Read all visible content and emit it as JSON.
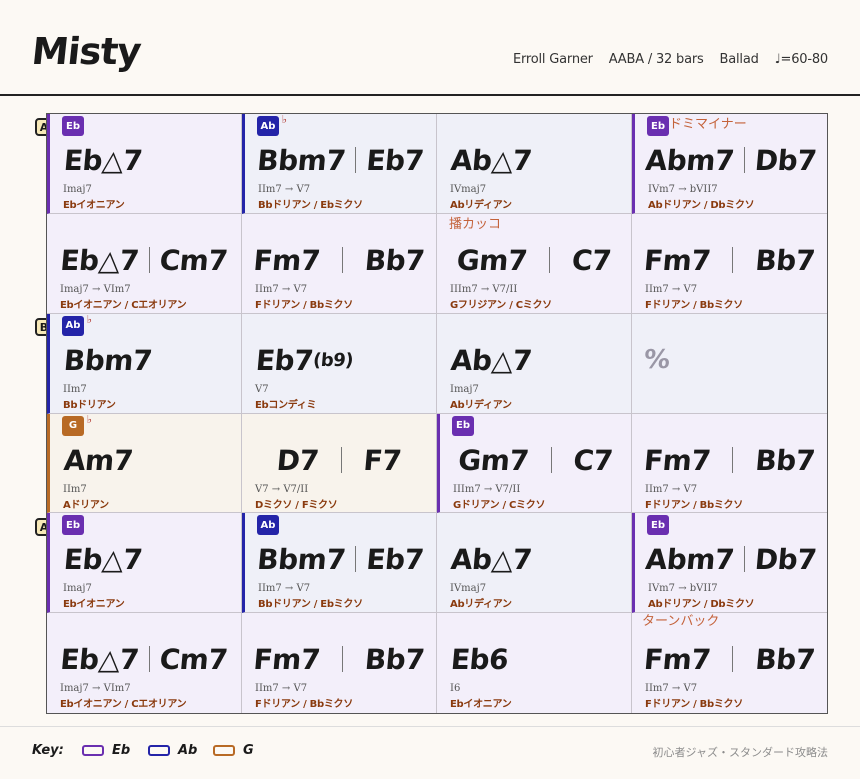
{
  "header": {
    "title": "Misty",
    "composer": "Erroll Garner",
    "form": "AABA / 32 bars",
    "style": "Ballad",
    "tempo": "♩=60-80"
  },
  "sections": [
    "A",
    "B",
    "A"
  ],
  "colors": {
    "Eb": "#6a2fb0",
    "Ab": "#2424a8",
    "G": "#b86a25"
  },
  "cells": [
    {
      "key": "Eb",
      "badge": "Eb",
      "chords": [
        "Eb△7"
      ],
      "roman": "Imaj7",
      "scale": "Ebイオニアン"
    },
    {
      "key": "Ab",
      "badge": "Ab",
      "flat": "♭",
      "chords": [
        "Bbm7",
        "Eb7"
      ],
      "roman": "IIm7 → V7",
      "scale": "Bbドリアン / Ebミクソ"
    },
    {
      "key": "Ab",
      "chords": [
        "Ab△7"
      ],
      "roman": "IVmaj7",
      "scale": "Abリディアン"
    },
    {
      "key": "Eb",
      "badge": "Eb",
      "note": "ドミマイナー",
      "chords": [
        "Abm7",
        "Db7"
      ],
      "roman": "IVm7 → bVII7",
      "scale": "Abドリアン / Dbミクソ"
    },
    {
      "key": "Eb",
      "chords": [
        "Eb△7",
        "Cm7"
      ],
      "roman": "Imaj7 → VIm7",
      "scale": "Ebイオニアン / Cエオリアン"
    },
    {
      "key": "Eb",
      "chords": [
        "Fm7",
        "Bb7"
      ],
      "wide": true,
      "roman": "IIm7 → V7",
      "scale": "Fドリアン / Bbミクソ"
    },
    {
      "key": "Eb",
      "note": "播カッコ",
      "chords": [
        "Gm7",
        "C7"
      ],
      "wide": true,
      "roman": "IIIm7 → V7/II",
      "scale": "Gフリジアン / Cミクソ"
    },
    {
      "key": "Eb",
      "chords": [
        "Fm7",
        "Bb7"
      ],
      "wide": true,
      "roman": "IIm7 → V7",
      "scale": "Fドリアン / Bbミクソ"
    },
    {
      "key": "Ab",
      "badge": "Ab",
      "flat": "♭",
      "chords": [
        "Bbm7"
      ],
      "roman": "IIm7",
      "scale": "Bbドリアン"
    },
    {
      "key": "Ab",
      "chords": [
        "Eb7"
      ],
      "ext": "(b9)",
      "roman": "V7",
      "scale": "Ebコンディミ"
    },
    {
      "key": "Ab",
      "chords": [
        "Ab△7"
      ],
      "roman": "Imaj7",
      "scale": "Abリディアン"
    },
    {
      "key": "Ab",
      "chords": [
        "%"
      ],
      "repeat": true
    },
    {
      "key": "G",
      "badge": "G",
      "flat": "♭",
      "chords": [
        "Am7"
      ],
      "roman": "IIm7",
      "scale": "Aドリアン"
    },
    {
      "key": "G",
      "chords": [
        "D7",
        "F7"
      ],
      "wide": true,
      "roman": "V7 → V7/II",
      "scale": "Dミクソ / Fミクソ"
    },
    {
      "key": "Eb",
      "badge": "Eb",
      "chords": [
        "Gm7",
        "C7"
      ],
      "wide": true,
      "roman": "IIIm7 → V7/II",
      "scale": "Gドリアン / Cミクソ"
    },
    {
      "key": "Eb",
      "chords": [
        "Fm7",
        "Bb7"
      ],
      "wide": true,
      "roman": "IIm7 → V7",
      "scale": "Fドリアン / Bbミクソ"
    },
    {
      "key": "Eb",
      "badge": "Eb",
      "chords": [
        "Eb△7"
      ],
      "roman": "Imaj7",
      "scale": "Ebイオニアン"
    },
    {
      "key": "Ab",
      "badge": "Ab",
      "chords": [
        "Bbm7",
        "Eb7"
      ],
      "roman": "IIm7 → V7",
      "scale": "Bbドリアン / Ebミクソ"
    },
    {
      "key": "Ab",
      "chords": [
        "Ab△7"
      ],
      "roman": "IVmaj7",
      "scale": "Abリディアン"
    },
    {
      "key": "Eb",
      "badge": "Eb",
      "chords": [
        "Abm7",
        "Db7"
      ],
      "roman": "IVm7 → bVII7",
      "scale": "Abドリアン / Dbミクソ"
    },
    {
      "key": "Eb",
      "chords": [
        "Eb△7",
        "Cm7"
      ],
      "roman": "Imaj7 → VIm7",
      "scale": "Ebイオニアン / Cエオリアン"
    },
    {
      "key": "Eb",
      "chords": [
        "Fm7",
        "Bb7"
      ],
      "wide": true,
      "roman": "IIm7 → V7",
      "scale": "Fドリアン / Bbミクソ"
    },
    {
      "key": "Eb",
      "chords": [
        "Eb6"
      ],
      "roman": "I6",
      "scale": "Ebイオニアン"
    },
    {
      "key": "Eb",
      "note": "ターンバック",
      "noteBelow": true,
      "chords": [
        "Fm7",
        "Bb7"
      ],
      "wide": true,
      "roman": "IIm7 → V7",
      "scale": "Fドリアン / Bbミクソ"
    }
  ],
  "footer": {
    "key_label": "Key:",
    "legend": [
      {
        "name": "Eb",
        "color": "#6a2fb0"
      },
      {
        "name": "Ab",
        "color": "#2424a8"
      },
      {
        "name": "G",
        "color": "#b86a25"
      }
    ],
    "credit": "初心者ジャズ・スタンダード攻略法"
  }
}
